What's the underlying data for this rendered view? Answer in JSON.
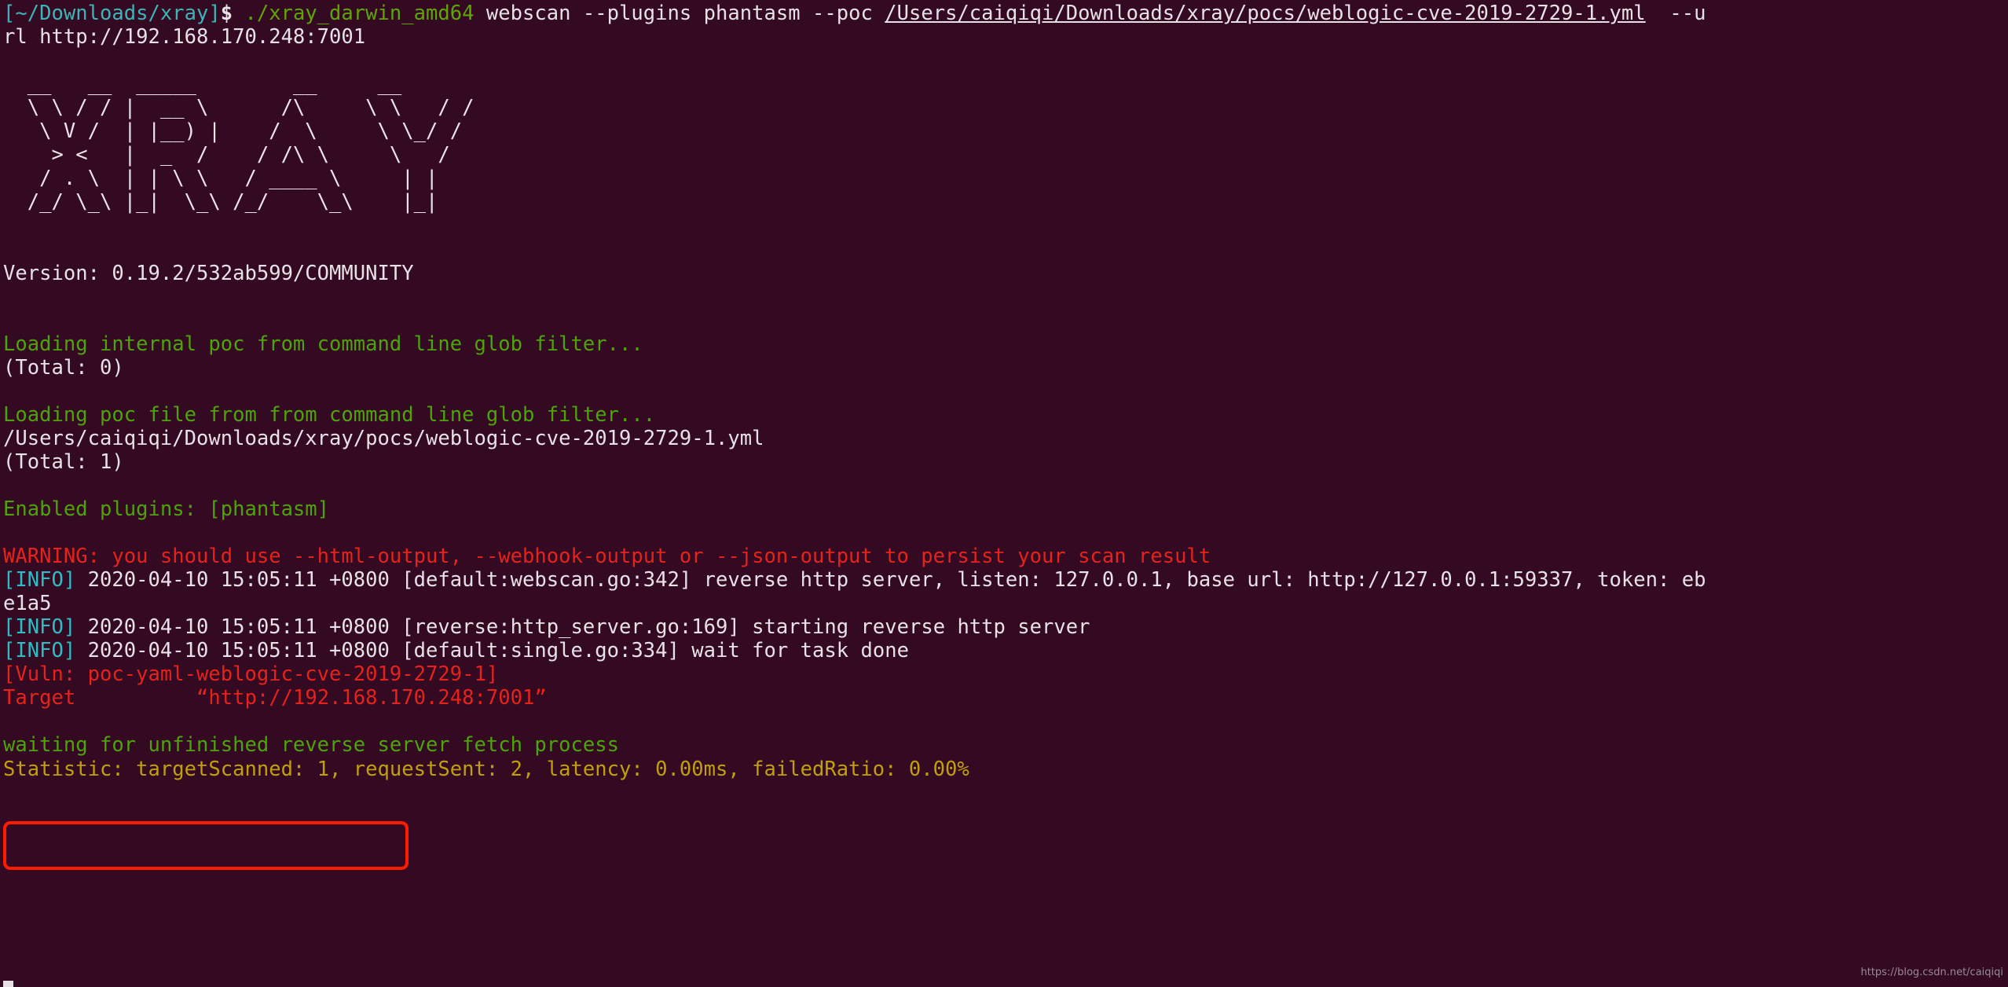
{
  "terminal": {
    "background_color": "#330A22",
    "foreground_color": "#E8E1E6",
    "prompt": {
      "path": "[~/Downloads/xray]",
      "symbol": "$",
      "command": "./xray_darwin_amd64",
      "args_before_path": " webscan --plugins phantasm --poc ",
      "poc_path": "/Users/caiqiqi/Downloads/xray/pocs/weblogic-cve-2019-2729-1.yml",
      "args_after_path": "  --u",
      "wrapped_continuation": "rl http://192.168.170.248:7001"
    },
    "ascii_art": [
      "  __   __  _____        __     __",
      "  \\ \\ / / |  __ \\      /\\     \\ \\   / /",
      "   \\ V /  | |__) |    /  \\     \\ \\_/ /",
      "    > <   |  _  /    / /\\ \\     \\   /",
      "   / . \\  | | \\ \\   / ____ \\     | |",
      "  /_/ \\_\\ |_|  \\_\\ /_/    \\_\\    |_|"
    ],
    "version_line": "Version: 0.19.2/532ab599/COMMUNITY",
    "log_lines": [
      {
        "name": "loading-internal-poc",
        "color": "green",
        "text": "Loading internal poc from command line glob filter..."
      },
      {
        "name": "internal-poc-total",
        "color": "white",
        "text": "(Total: 0)"
      },
      {
        "name": "loading-poc-file",
        "color": "green",
        "text": "Loading poc file from from command line glob filter..."
      },
      {
        "name": "poc-file-path",
        "color": "white",
        "text": "/Users/caiqiqi/Downloads/xray/pocs/weblogic-cve-2019-2729-1.yml"
      },
      {
        "name": "poc-file-total",
        "color": "white",
        "text": "(Total: 1)"
      },
      {
        "name": "enabled-plugins",
        "color": "green",
        "text": "Enabled plugins: [phantasm]"
      },
      {
        "name": "warning-persist-result",
        "color": "red",
        "text": "WARNING: you should use --html-output, --webhook-output or --json-output to persist your scan result"
      }
    ],
    "info_lines": [
      {
        "tag": "[INFO]",
        "timestamp": "2020-04-10 15:05:11 +0800",
        "source": "[default:webscan.go:342]",
        "message": "reverse http server, listen: 127.0.0.1, base url: http://127.0.0.1:59337, token: eb",
        "wrap": "e1a5"
      },
      {
        "tag": "[INFO]",
        "timestamp": "2020-04-10 15:05:11 +0800",
        "source": "[reverse:http_server.go:169]",
        "message": "starting reverse http server",
        "wrap": ""
      },
      {
        "tag": "[INFO]",
        "timestamp": "2020-04-10 15:05:11 +0800",
        "source": "[default:single.go:334]",
        "message": "wait for task done",
        "wrap": ""
      }
    ],
    "vuln_block": {
      "highlight_color": "#FF1A00",
      "title": "[Vuln: poc-yaml-weblogic-cve-2019-2729-1]",
      "target_label": "Target",
      "target_value": "“http://192.168.170.248:7001”"
    },
    "footer_lines": [
      {
        "name": "waiting-reverse-fetch",
        "color": "green",
        "text": "waiting for unfinished reverse server fetch process"
      },
      {
        "name": "statistic-line",
        "color": "olive",
        "text": "Statistic: targetScanned: 1, requestSent: 2, latency: 0.00ms, failedRatio: 0.00%"
      }
    ],
    "watermark": "https://blog.csdn.net/caiqiqi"
  }
}
